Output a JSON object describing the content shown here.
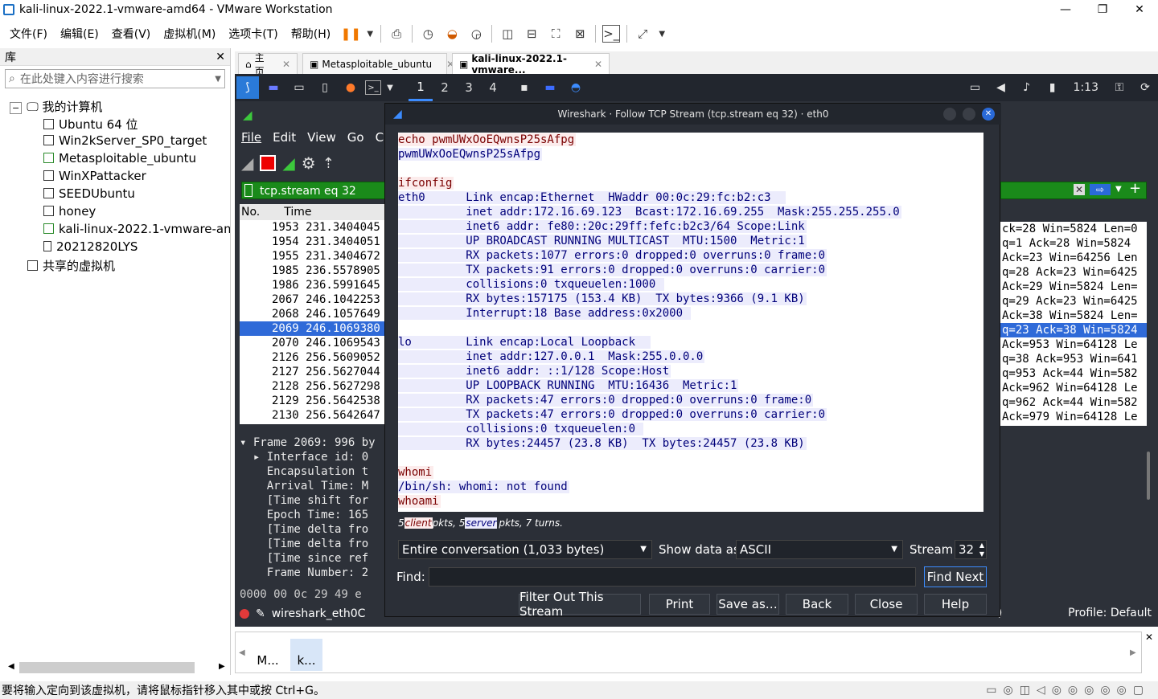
{
  "window": {
    "title": "kali-linux-2022.1-vmware-amd64 - VMware Workstation"
  },
  "menu": [
    "文件(F)",
    "编辑(E)",
    "查看(V)",
    "虚拟机(M)",
    "选项卡(T)",
    "帮助(H)"
  ],
  "library": {
    "title": "库",
    "search_placeholder": "在此处键入内容进行搜索",
    "root": "我的计算机",
    "vms": [
      "Ubuntu 64 位",
      "Win2kServer_SP0_target",
      "Metasploitable_ubuntu",
      "WinXPattacker",
      "SEEDUbuntu",
      "honey",
      "kali-linux-2022.1-vmware-am",
      "20212820LYS"
    ],
    "shared": "共享的虚拟机"
  },
  "tabs": [
    {
      "label": "主页",
      "active": false
    },
    {
      "label": "Metasploitable_ubuntu",
      "active": false
    },
    {
      "label": "kali-linux-2022.1-vmware...",
      "active": true
    }
  ],
  "kali": {
    "workspaces": [
      "1",
      "2",
      "3",
      "4"
    ],
    "active_workspace": "1",
    "clock": "1:13"
  },
  "wireshark": {
    "menu": [
      "File",
      "Edit",
      "View",
      "Go",
      "C"
    ],
    "filter": "tcp.stream eq 32",
    "columns": [
      "No.",
      "Time"
    ],
    "packets": [
      {
        "text": "1953 231.3404045",
        "selected": false
      },
      {
        "text": "1954 231.3404051",
        "selected": false
      },
      {
        "text": "1955 231.3404672",
        "selected": false
      },
      {
        "text": "1985 236.5578905",
        "selected": false
      },
      {
        "text": "1986 236.5991645",
        "selected": false
      },
      {
        "text": "2067 246.1042253",
        "selected": false
      },
      {
        "text": "2068 246.1057649",
        "selected": false
      },
      {
        "text": "2069 246.1069380",
        "selected": true
      },
      {
        "text": "2070 246.1069543",
        "selected": false
      },
      {
        "text": "2126 256.5609052",
        "selected": false
      },
      {
        "text": "2127 256.5627044",
        "selected": false
      },
      {
        "text": "2128 256.5627298",
        "selected": false
      },
      {
        "text": "2129 256.5642538",
        "selected": false
      },
      {
        "text": "2130 256.5642647",
        "selected": false
      }
    ],
    "right_rows": [
      {
        "text": "ck=28 Win=5824 Len=0",
        "selected": false
      },
      {
        "text": "q=1 Ack=28 Win=5824",
        "selected": false
      },
      {
        "text": "Ack=23 Win=64256 Len",
        "selected": false
      },
      {
        "text": "q=28 Ack=23 Win=6425",
        "selected": false
      },
      {
        "text": "Ack=29 Win=5824 Len=",
        "selected": false
      },
      {
        "text": "q=29 Ack=23 Win=6425",
        "selected": false
      },
      {
        "text": "Ack=38 Win=5824 Len=",
        "selected": false
      },
      {
        "text": "q=23 Ack=38 Win=5824",
        "selected": true
      },
      {
        "text": "Ack=953 Win=64128 Le",
        "selected": false
      },
      {
        "text": "q=38 Ack=953 Win=641",
        "selected": false
      },
      {
        "text": "q=953 Ack=44 Win=582",
        "selected": false
      },
      {
        "text": "Ack=962 Win=64128 Le",
        "selected": false
      },
      {
        "text": "q=962 Ack=44 Win=582",
        "selected": false
      },
      {
        "text": "Ack=979 Win=64128 Le",
        "selected": false
      }
    ],
    "details": [
      "▾ Frame 2069: 996 by",
      "  ▸ Interface id: 0",
      "    Encapsulation t",
      "    Arrival Time: M",
      "    [Time shift for",
      "    Epoch Time: 165",
      "    [Time delta fro",
      "    [Time delta fro",
      "    [Time since ref",
      "    Frame Number: 2"
    ],
    "hex": "0000   00 0c 29 49 e",
    "interface": "wireshark_eth0C",
    "profile": "Profile: Default",
    "right_status_prefix": "5)"
  },
  "dialog": {
    "title": "Wireshark · Follow TCP Stream (tcp.stream eq 32) · eth0",
    "lines": [
      {
        "t": "echo pwmUWxOoEQwnsP25sAfpg",
        "k": "c"
      },
      {
        "t": "pwmUWxOoEQwnsP25sAfpg",
        "k": "s"
      },
      {
        "t": "",
        "k": "n"
      },
      {
        "t": "ifconfig",
        "k": "c"
      },
      {
        "t": "eth0      Link encap:Ethernet  HWaddr 00:0c:29:fc:b2:c3  ",
        "k": "s"
      },
      {
        "t": "          inet addr:172.16.69.123  Bcast:172.16.69.255  Mask:255.255.255.0",
        "k": "s"
      },
      {
        "t": "          inet6 addr: fe80::20c:29ff:fefc:b2c3/64 Scope:Link",
        "k": "s"
      },
      {
        "t": "          UP BROADCAST RUNNING MULTICAST  MTU:1500  Metric:1",
        "k": "s"
      },
      {
        "t": "          RX packets:1077 errors:0 dropped:0 overruns:0 frame:0",
        "k": "s"
      },
      {
        "t": "          TX packets:91 errors:0 dropped:0 overruns:0 carrier:0",
        "k": "s"
      },
      {
        "t": "          collisions:0 txqueuelen:1000 ",
        "k": "s"
      },
      {
        "t": "          RX bytes:157175 (153.4 KB)  TX bytes:9366 (9.1 KB)",
        "k": "s"
      },
      {
        "t": "          Interrupt:18 Base address:0x2000 ",
        "k": "s"
      },
      {
        "t": "",
        "k": "n"
      },
      {
        "t": "lo        Link encap:Local Loopback  ",
        "k": "s"
      },
      {
        "t": "          inet addr:127.0.0.1  Mask:255.0.0.0",
        "k": "s"
      },
      {
        "t": "          inet6 addr: ::1/128 Scope:Host",
        "k": "s"
      },
      {
        "t": "          UP LOOPBACK RUNNING  MTU:16436  Metric:1",
        "k": "s"
      },
      {
        "t": "          RX packets:47 errors:0 dropped:0 overruns:0 frame:0",
        "k": "s"
      },
      {
        "t": "          TX packets:47 errors:0 dropped:0 overruns:0 carrier:0",
        "k": "s"
      },
      {
        "t": "          collisions:0 txqueuelen:0 ",
        "k": "s"
      },
      {
        "t": "          RX bytes:24457 (23.8 KB)  TX bytes:24457 (23.8 KB)",
        "k": "s"
      },
      {
        "t": "",
        "k": "n"
      },
      {
        "t": "whomi",
        "k": "c"
      },
      {
        "t": "/bin/sh: whomi: not found",
        "k": "s"
      },
      {
        "t": "whoami",
        "k": "c"
      }
    ],
    "summary": {
      "client_count": "5",
      "client_tag": "client",
      "mid": "pkts, ",
      "server_count": "5",
      "server_tag": "server",
      "tail": "pkts, 7 turns."
    },
    "conversation": "Entire conversation (1,033 bytes)",
    "show_data_label": "Show data as",
    "show_data_value": "ASCII",
    "stream_label": "Stream",
    "stream_value": "32",
    "find_label": "Find:",
    "find_next": "Find Next",
    "buttons": [
      "Filter Out This Stream",
      "Print",
      "Save as…",
      "Back",
      "Close",
      "Help"
    ]
  },
  "thumbnails": [
    "M...",
    "k..."
  ],
  "statusbar": "要将输入定向到该虚拟机，请将鼠标指针移入其中或按 Ctrl+G。"
}
